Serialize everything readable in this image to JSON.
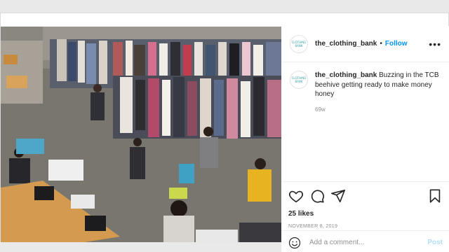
{
  "post": {
    "username": "the_clothing_bank",
    "follow_label": "Follow",
    "dot": "•",
    "more_label": "•••",
    "avatar_text": "CLOTHING BANK",
    "caption": "Buzzing in the TCB beehive getting ready to make money honey",
    "time_ago": "69w",
    "likes": "25 likes",
    "date": "NOVEMBER 8, 2019",
    "comment_placeholder": "Add a comment...",
    "post_label": "Post"
  },
  "icons": {
    "like": "heart-icon",
    "comment": "comment-icon",
    "share": "share-icon",
    "save": "bookmark-icon",
    "emoji": "emoji-icon",
    "more": "more-icon"
  },
  "colors": {
    "link": "#0095f6",
    "post_disabled": "#b2dffc",
    "text": "#262626",
    "muted": "#8e8e8e"
  }
}
